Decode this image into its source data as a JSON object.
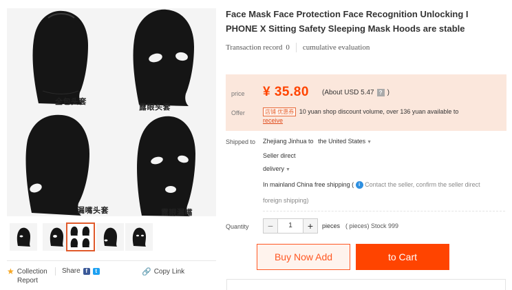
{
  "product": {
    "title": "Face Mask Face Protection Face Recognition Unlocking I PHONE X Sitting Safety Sleeping Mask Hoods are stable",
    "transaction_record_label": "Transaction record",
    "transaction_record_count": "0",
    "cumulative_evaluation_label": "cumulative evaluation"
  },
  "gallery": {
    "captions": [
      "全包头套",
      "露眼头套",
      "漏嘴头套",
      "露眼漏嘴"
    ],
    "thumbnail_count": 5,
    "active_thumbnail": 3
  },
  "actions": {
    "collection_label": "Collection",
    "share_label": "Share",
    "copy_link_label": "Copy Link",
    "report_label": "Report",
    "facebook_glyph": "f",
    "twitter_glyph": "t"
  },
  "price": {
    "label": "price",
    "value": "¥ 35.80",
    "usd_text": "(About USD 5.47",
    "usd_close": ")",
    "help_glyph": "?",
    "offer_label": "Offer",
    "coupon_tag": "店铺 优惠券",
    "offer_text": "10 yuan shop discount volume, over 136 yuan available to",
    "receive_label": "receive"
  },
  "shipping": {
    "label": "Shipped to",
    "origin": "Zhejiang Jinhua to",
    "destination": "the United States",
    "seller_direct": "Seller direct",
    "delivery": "delivery",
    "free_shipping": "In mainland China free shipping (",
    "contact_text": "Contact the seller, confirm the seller direct",
    "foreign_shipping": "foreign shipping)",
    "info_glyph": "i"
  },
  "quantity": {
    "label": "Quantity",
    "value": "1",
    "unit": "pieces",
    "stock": "( pieces) Stock 999",
    "minus": "−",
    "plus": "+"
  },
  "buttons": {
    "buy_now": "Buy Now Add",
    "to_cart": "to Cart"
  },
  "colors": {
    "accent": "#ff4400",
    "price_bg": "#fbe7dc",
    "mask": "#151515"
  }
}
